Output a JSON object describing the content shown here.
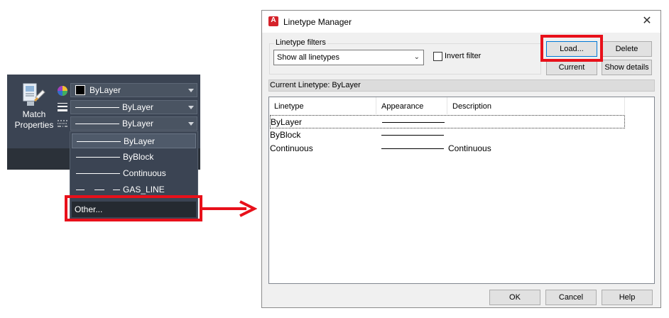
{
  "ribbon": {
    "match_properties_label": "Match\nProperties",
    "color_combo": "ByLayer",
    "lineweight_combo": "ByLayer",
    "linetype_combo": "ByLayer"
  },
  "linetype_dropdown": {
    "items": [
      "ByLayer",
      "ByBlock",
      "Continuous",
      "GAS_LINE"
    ],
    "selected": "ByLayer",
    "other_label": "Other..."
  },
  "dialog": {
    "title": "Linetype Manager",
    "app_icon_letter": "A",
    "filters_label": "Linetype filters",
    "filter_value": "Show all linetypes",
    "invert_filter_label": "Invert filter",
    "buttons": {
      "load": "Load...",
      "delete": "Delete",
      "current": "Current",
      "show_details": "Show details",
      "ok": "OK",
      "cancel": "Cancel",
      "help": "Help"
    },
    "current_linetype_label": "Current Linetype:  ByLayer",
    "columns": [
      "Linetype",
      "Appearance",
      "Description"
    ],
    "rows": [
      {
        "linetype": "ByLayer",
        "description": ""
      },
      {
        "linetype": "ByBlock",
        "description": ""
      },
      {
        "linetype": "Continuous",
        "description": "Continuous"
      }
    ]
  },
  "colors": {
    "highlight_red": "#e8101a",
    "ribbon_bg": "#3b4453",
    "dialog_bg": "#f0f0f0"
  }
}
